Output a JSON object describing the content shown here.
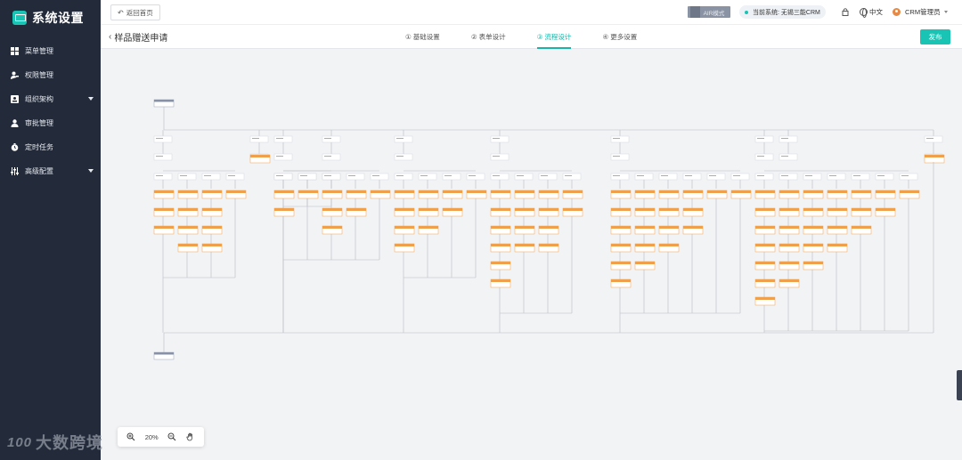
{
  "app": {
    "title": "系统设置"
  },
  "sidebar": {
    "items": [
      {
        "label": "菜单管理",
        "icon": "grid-icon",
        "has_children": false
      },
      {
        "label": "权限管理",
        "icon": "user-key-icon",
        "has_children": false
      },
      {
        "label": "组织架构",
        "icon": "org-chart-icon",
        "has_children": true
      },
      {
        "label": "审批管理",
        "icon": "person-icon",
        "has_children": false
      },
      {
        "label": "定时任务",
        "icon": "clock-icon",
        "has_children": false
      },
      {
        "label": "高级配置",
        "icon": "sliders-icon",
        "has_children": true
      }
    ]
  },
  "topbar": {
    "back_label": "返回首页",
    "air_mode_label": "AIR模式",
    "system_label": "当前系统: 无锡三能CRM",
    "language_label": "中文",
    "user_label": "CRM管理员"
  },
  "subbar": {
    "form_title": "样品赠送申请",
    "steps": [
      {
        "label": "① 基础设置",
        "active": false
      },
      {
        "label": "② 表单设计",
        "active": false
      },
      {
        "label": "③ 流程设计",
        "active": true
      },
      {
        "label": "④ 更多设置",
        "active": false
      }
    ],
    "publish_label": "发布"
  },
  "zoom": {
    "level": "20%"
  },
  "watermark": {
    "logo": "100",
    "text": "大数跨境"
  },
  "colors": {
    "sidebar_bg": "#232b3b",
    "accent": "#19c4b4",
    "node_orange": "#f0a04b",
    "node_grey": "#c9cdd6"
  }
}
